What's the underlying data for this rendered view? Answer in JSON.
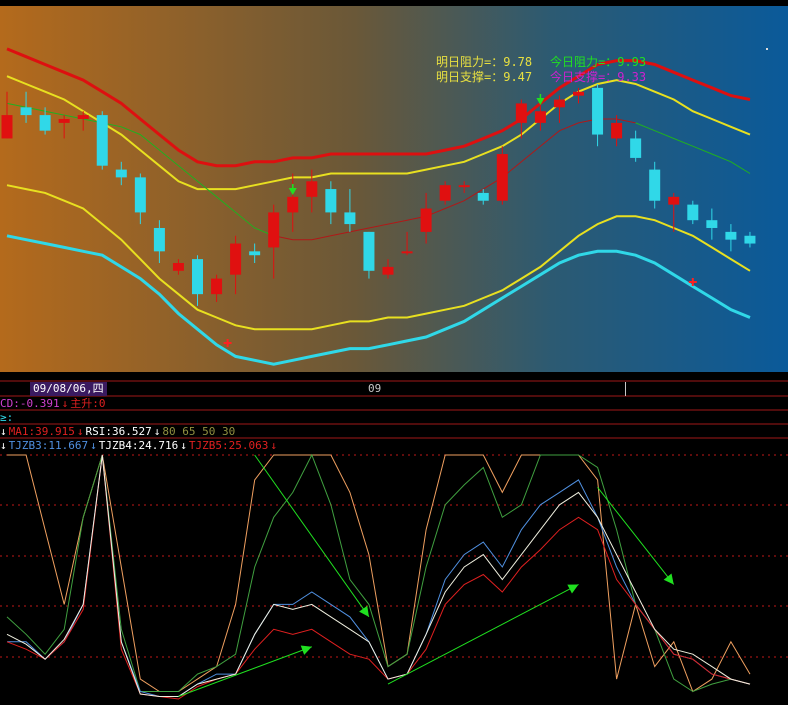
{
  "colors": {
    "bg_left": "#b46a1c",
    "bg_right": "#0a5a9a",
    "up": "#e01010",
    "down": "#30d8e8",
    "band_outer": "#dd1010",
    "band_inner": "#e8e020",
    "band_mid_green": "#20b020",
    "band_mid_red": "#b01818",
    "band_lower": "#30d8e8",
    "grid_red": "#c01818",
    "annot_yellow": "#e8e040",
    "annot_green": "#20e020",
    "annot_magenta": "#d020d0"
  },
  "annotations": {
    "tomorrow_resistance": "明日阻力=：9.78",
    "today_resistance": "今日阻力=：9.93",
    "tomorrow_support": "明日支撑=：9.47",
    "today_support": "今日支撑=：9.33"
  },
  "status": {
    "date": "09/08/06,四",
    "month_tick": "09",
    "macd_label": "CD:-0.391",
    "main_rise_label": "主升:0",
    "third_row_char": "≥:",
    "ma1": "MA1:39.915",
    "rsi": "RSI:36.527",
    "rsi_levels": "80 65 50 30",
    "tjzb3": "TJZB3:11.667",
    "tjzb4": "TJZB4:24.716",
    "tjzb5": "TJZB5:25.063"
  },
  "chart_data": [
    {
      "type": "candlestick",
      "candles": [
        {
          "o": 9.9,
          "h": 9.96,
          "l": 9.86,
          "c": 9.84,
          "d": "up"
        },
        {
          "o": 9.92,
          "h": 9.96,
          "l": 9.88,
          "c": 9.9,
          "d": "down"
        },
        {
          "o": 9.9,
          "h": 9.92,
          "l": 9.85,
          "c": 9.86,
          "d": "down"
        },
        {
          "o": 9.88,
          "h": 9.9,
          "l": 9.84,
          "c": 9.89,
          "d": "up"
        },
        {
          "o": 9.89,
          "h": 9.91,
          "l": 9.86,
          "c": 9.9,
          "d": "up"
        },
        {
          "o": 9.9,
          "h": 9.91,
          "l": 9.76,
          "c": 9.77,
          "d": "down"
        },
        {
          "o": 9.76,
          "h": 9.78,
          "l": 9.72,
          "c": 9.74,
          "d": "down"
        },
        {
          "o": 9.74,
          "h": 9.75,
          "l": 9.62,
          "c": 9.65,
          "d": "down"
        },
        {
          "o": 9.61,
          "h": 9.63,
          "l": 9.52,
          "c": 9.55,
          "d": "down"
        },
        {
          "o": 9.52,
          "h": 9.53,
          "l": 9.49,
          "c": 9.5,
          "d": "up"
        },
        {
          "o": 9.53,
          "h": 9.54,
          "l": 9.41,
          "c": 9.44,
          "d": "down"
        },
        {
          "o": 9.48,
          "h": 9.49,
          "l": 9.42,
          "c": 9.44,
          "d": "up"
        },
        {
          "o": 9.49,
          "h": 9.59,
          "l": 9.44,
          "c": 9.57,
          "d": "up"
        },
        {
          "o": 9.55,
          "h": 9.57,
          "l": 9.52,
          "c": 9.54,
          "d": "down"
        },
        {
          "o": 9.56,
          "h": 9.67,
          "l": 9.48,
          "c": 9.65,
          "d": "up"
        },
        {
          "o": 9.65,
          "h": 9.75,
          "l": 9.6,
          "c": 9.69,
          "d": "up"
        },
        {
          "o": 9.69,
          "h": 9.76,
          "l": 9.65,
          "c": 9.73,
          "d": "up"
        },
        {
          "o": 9.71,
          "h": 9.73,
          "l": 9.62,
          "c": 9.65,
          "d": "down"
        },
        {
          "o": 9.65,
          "h": 9.71,
          "l": 9.6,
          "c": 9.62,
          "d": "down"
        },
        {
          "o": 9.6,
          "h": 9.56,
          "l": 9.48,
          "c": 9.5,
          "d": "down"
        },
        {
          "o": 9.51,
          "h": 9.53,
          "l": 9.48,
          "c": 9.49,
          "d": "up"
        },
        {
          "o": 9.55,
          "h": 9.6,
          "l": 9.54,
          "c": 9.55,
          "d": "up"
        },
        {
          "o": 9.6,
          "h": 9.7,
          "l": 9.57,
          "c": 9.66,
          "d": "up"
        },
        {
          "o": 9.68,
          "h": 9.73,
          "l": 9.67,
          "c": 9.72,
          "d": "up"
        },
        {
          "o": 9.72,
          "h": 9.73,
          "l": 9.7,
          "c": 9.72,
          "d": "up"
        },
        {
          "o": 9.7,
          "h": 9.71,
          "l": 9.67,
          "c": 9.68,
          "d": "down"
        },
        {
          "o": 9.68,
          "h": 9.82,
          "l": 9.67,
          "c": 9.8,
          "d": "up"
        },
        {
          "o": 9.88,
          "h": 9.94,
          "l": 9.84,
          "c": 9.93,
          "d": "up"
        },
        {
          "o": 9.88,
          "h": 9.93,
          "l": 9.86,
          "c": 9.91,
          "d": "up"
        },
        {
          "o": 9.92,
          "h": 9.95,
          "l": 9.88,
          "c": 9.94,
          "d": "up"
        },
        {
          "o": 9.95,
          "h": 9.97,
          "l": 9.93,
          "c": 9.96,
          "d": "up"
        },
        {
          "o": 9.97,
          "h": 9.98,
          "l": 9.82,
          "c": 9.85,
          "d": "down"
        },
        {
          "o": 9.88,
          "h": 9.9,
          "l": 9.82,
          "c": 9.84,
          "d": "up"
        },
        {
          "o": 9.84,
          "h": 9.86,
          "l": 9.78,
          "c": 9.79,
          "d": "down"
        },
        {
          "o": 9.76,
          "h": 9.78,
          "l": 9.66,
          "c": 9.68,
          "d": "down"
        },
        {
          "o": 9.69,
          "h": 9.7,
          "l": 9.6,
          "c": 9.67,
          "d": "up"
        },
        {
          "o": 9.67,
          "h": 9.68,
          "l": 9.62,
          "c": 9.63,
          "d": "down"
        },
        {
          "o": 9.63,
          "h": 9.66,
          "l": 9.58,
          "c": 9.61,
          "d": "down"
        },
        {
          "o": 9.6,
          "h": 9.62,
          "l": 9.55,
          "c": 9.58,
          "d": "down"
        },
        {
          "o": 9.59,
          "h": 9.6,
          "l": 9.56,
          "c": 9.57,
          "d": "down"
        }
      ],
      "bands": {
        "outer_upper": [
          10.07,
          10.05,
          10.03,
          10.01,
          9.99,
          9.96,
          9.93,
          9.89,
          9.85,
          9.81,
          9.78,
          9.77,
          9.77,
          9.78,
          9.78,
          9.79,
          9.79,
          9.8,
          9.8,
          9.8,
          9.8,
          9.8,
          9.8,
          9.81,
          9.82,
          9.84,
          9.86,
          9.89,
          9.93,
          9.97,
          10.0,
          10.03,
          10.04,
          10.04,
          10.03,
          10.01,
          9.99,
          9.97,
          9.95,
          9.94
        ],
        "inner_upper": [
          10.0,
          9.98,
          9.96,
          9.94,
          9.91,
          9.88,
          9.85,
          9.81,
          9.77,
          9.73,
          9.71,
          9.71,
          9.71,
          9.72,
          9.73,
          9.74,
          9.74,
          9.75,
          9.75,
          9.75,
          9.75,
          9.75,
          9.76,
          9.77,
          9.78,
          9.8,
          9.82,
          9.85,
          9.89,
          9.93,
          9.96,
          9.98,
          9.99,
          9.98,
          9.96,
          9.94,
          9.91,
          9.89,
          9.87,
          9.85
        ],
        "mid_upper": [
          9.93,
          9.92,
          9.91,
          9.9,
          9.89,
          9.88,
          9.87,
          9.85,
          9.81,
          9.77,
          9.73,
          9.69,
          9.65,
          9.61,
          9.59,
          9.58,
          9.58,
          9.59,
          9.6,
          9.61,
          9.62,
          9.63,
          9.64,
          9.66,
          9.68,
          9.71,
          9.74,
          9.78,
          9.82,
          9.86,
          9.88,
          9.89,
          9.89,
          9.88,
          9.86,
          9.84,
          9.82,
          9.8,
          9.78,
          9.75
        ],
        "inner_lower": [
          9.72,
          9.71,
          9.7,
          9.68,
          9.66,
          9.62,
          9.58,
          9.53,
          9.48,
          9.44,
          9.4,
          9.38,
          9.36,
          9.35,
          9.35,
          9.35,
          9.35,
          9.36,
          9.37,
          9.37,
          9.38,
          9.38,
          9.39,
          9.4,
          9.41,
          9.43,
          9.45,
          9.48,
          9.51,
          9.55,
          9.59,
          9.62,
          9.64,
          9.64,
          9.63,
          9.61,
          9.59,
          9.56,
          9.53,
          9.5
        ],
        "outer_lower": [
          9.59,
          9.58,
          9.57,
          9.56,
          9.55,
          9.54,
          9.51,
          9.48,
          9.44,
          9.39,
          9.35,
          9.31,
          9.28,
          9.27,
          9.26,
          9.27,
          9.28,
          9.29,
          9.3,
          9.3,
          9.31,
          9.32,
          9.33,
          9.35,
          9.37,
          9.4,
          9.43,
          9.46,
          9.49,
          9.52,
          9.54,
          9.55,
          9.55,
          9.54,
          9.52,
          9.49,
          9.46,
          9.43,
          9.4,
          9.38
        ]
      },
      "ylim": [
        9.24,
        10.17
      ]
    },
    {
      "type": "line",
      "ylim": [
        0,
        100
      ],
      "series": [
        {
          "color": "#f0a060",
          "values": [
            100,
            100,
            70,
            40,
            75,
            100,
            55,
            10,
            5,
            5,
            10,
            15,
            40,
            90,
            100,
            100,
            100,
            100,
            85,
            60,
            15,
            20,
            70,
            100,
            100,
            100,
            85,
            100,
            100,
            100,
            100,
            90,
            10,
            40,
            15,
            25,
            5,
            10,
            25,
            12
          ]
        },
        {
          "color": "#40a040",
          "values": [
            35,
            28,
            20,
            30,
            75,
            100,
            30,
            5,
            5,
            5,
            12,
            15,
            20,
            55,
            75,
            85,
            100,
            80,
            50,
            40,
            15,
            20,
            55,
            80,
            88,
            95,
            75,
            80,
            100,
            100,
            100,
            95,
            70,
            40,
            30,
            10,
            5,
            8,
            10,
            8
          ]
        },
        {
          "color": "#5090e0",
          "values": [
            25,
            25,
            18,
            25,
            40,
            100,
            25,
            5,
            3,
            3,
            8,
            12,
            12,
            28,
            40,
            40,
            45,
            40,
            35,
            25,
            10,
            12,
            28,
            50,
            60,
            65,
            55,
            70,
            80,
            85,
            90,
            75,
            55,
            40,
            30,
            20,
            18,
            12,
            10,
            8
          ]
        },
        {
          "color": "#e02020",
          "values": [
            25,
            22,
            18,
            25,
            38,
            100,
            22,
            4,
            3,
            2,
            7,
            10,
            12,
            22,
            30,
            28,
            30,
            25,
            20,
            18,
            10,
            12,
            22,
            40,
            48,
            52,
            45,
            55,
            62,
            70,
            75,
            70,
            50,
            40,
            30,
            20,
            18,
            12,
            10,
            8
          ]
        },
        {
          "color": "#f0f0e0",
          "values": [
            28,
            24,
            18,
            26,
            40,
            100,
            25,
            4,
            3,
            3,
            8,
            10,
            12,
            28,
            40,
            38,
            40,
            35,
            30,
            25,
            10,
            12,
            28,
            45,
            55,
            60,
            50,
            60,
            70,
            80,
            85,
            75,
            60,
            45,
            30,
            22,
            20,
            15,
            10,
            8
          ]
        }
      ],
      "trend_arrows": [
        {
          "x0": 9,
          "y0": 3,
          "x1": 16,
          "y1": 23
        },
        {
          "x0": 13,
          "y0": 100,
          "x1": 19,
          "y1": 35
        },
        {
          "x0": 20,
          "y0": 8,
          "x1": 30,
          "y1": 48
        },
        {
          "x0": 31,
          "y0": 87,
          "x1": 35,
          "y1": 48
        }
      ]
    }
  ]
}
